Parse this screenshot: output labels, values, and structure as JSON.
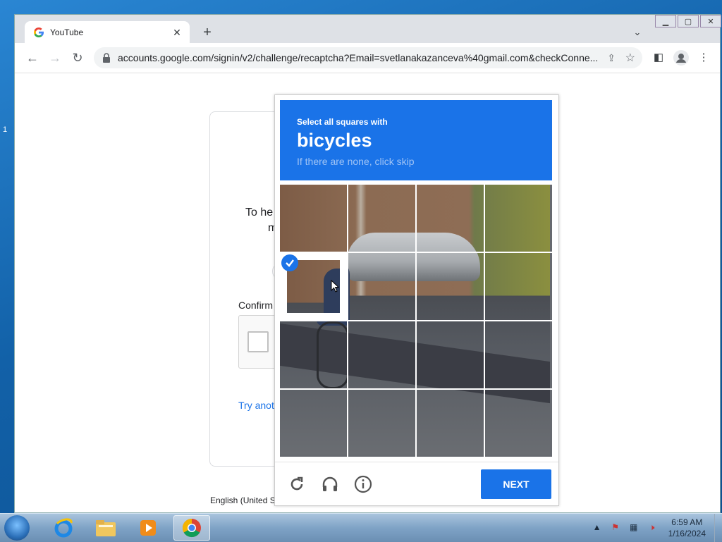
{
  "browser": {
    "tab_title": "YouTube",
    "url": "accounts.google.com/signin/v2/challenge/recaptcha?Email=svetlanakazanceva%40gmail.com&checkConne..."
  },
  "page": {
    "help_text_line1": "To he",
    "help_text_line2": "m",
    "confirm_label": "Confirm",
    "try_another": "Try anot",
    "language": "English (United S"
  },
  "captcha": {
    "instruction": "Select all squares with",
    "target": "bicycles",
    "subtitle": "If there are none, click skip",
    "next_label": "NEXT",
    "selected_tiles": [
      4
    ],
    "icons": [
      "reload-icon",
      "audio-icon",
      "info-icon"
    ]
  },
  "taskbar": {
    "time": "6:59 AM",
    "date": "1/16/2024",
    "apps": [
      "internet-explorer-icon",
      "file-explorer-icon",
      "media-player-icon",
      "chrome-icon"
    ]
  },
  "colors": {
    "accent": "#1a73e8",
    "taskbar": "#7fa3c6"
  }
}
